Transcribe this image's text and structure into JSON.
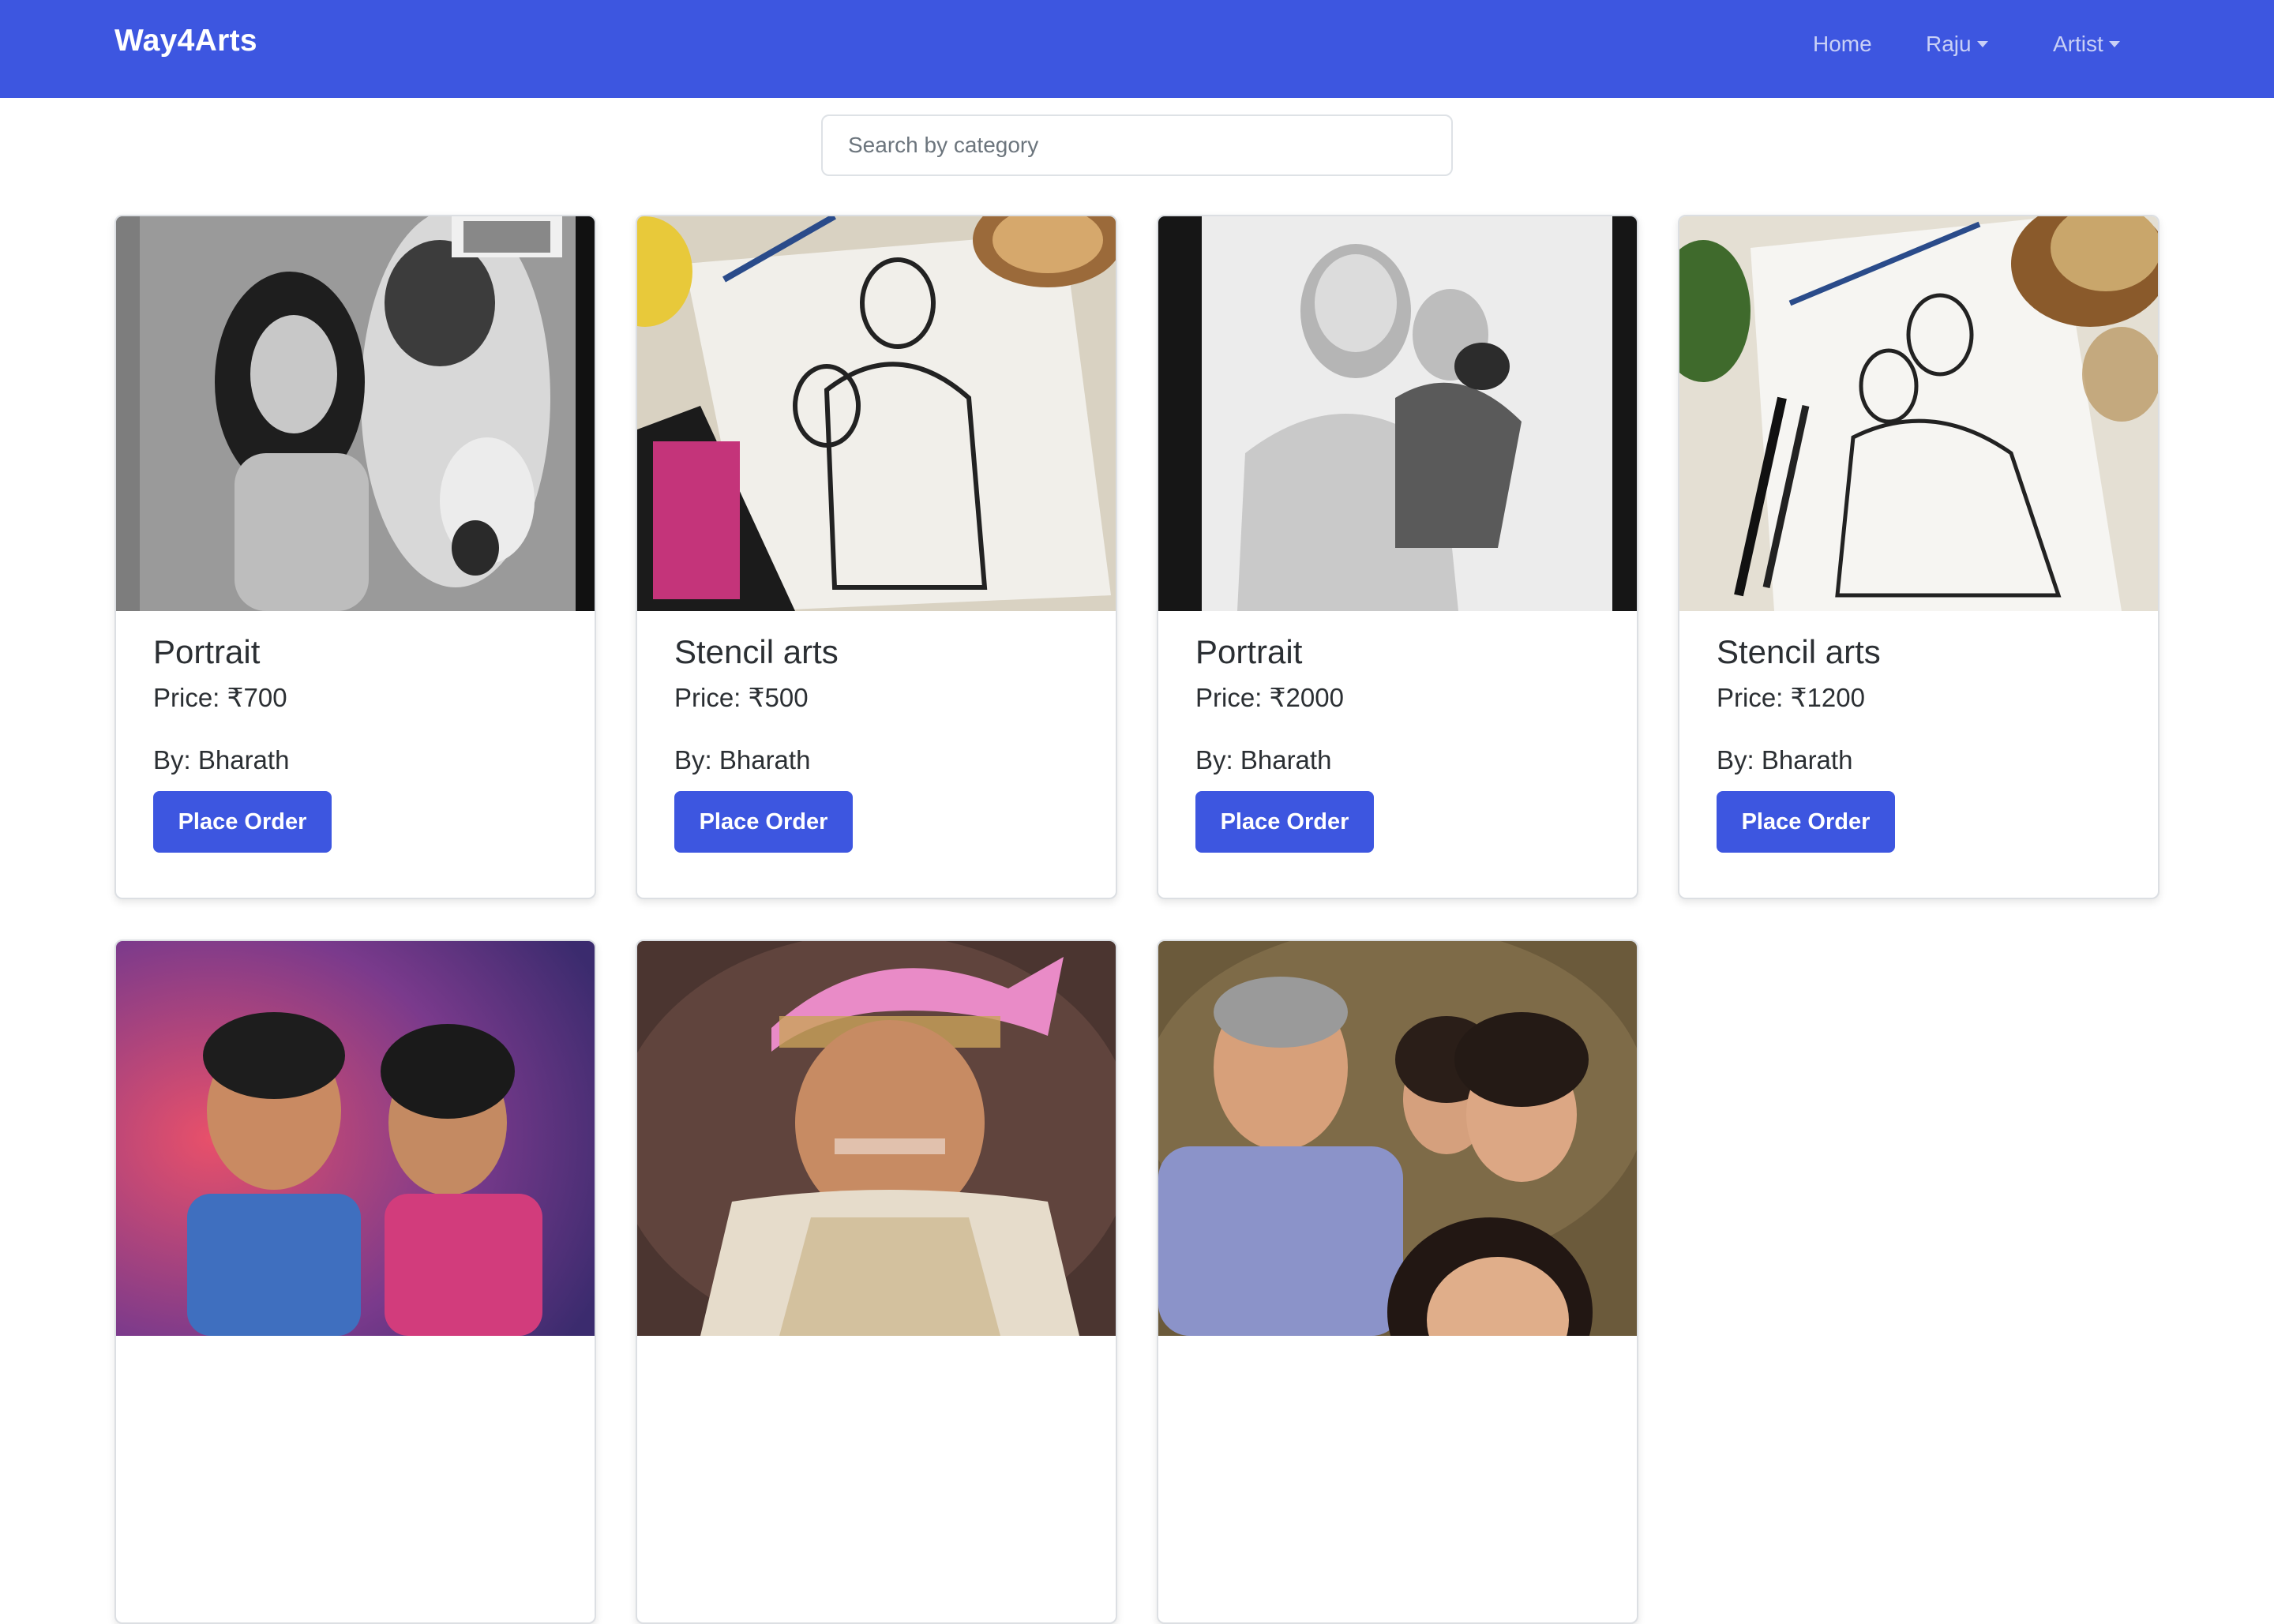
{
  "navbar": {
    "brand": "Way4Arts",
    "links": [
      {
        "label": "Home",
        "dropdown": false
      },
      {
        "label": "Raju",
        "dropdown": true
      },
      {
        "label": "Artist",
        "dropdown": true
      }
    ],
    "color": "#3d56e0"
  },
  "search": {
    "placeholder": "Search by category",
    "value": ""
  },
  "cards": [
    {
      "title": "Portrait",
      "price": "Price: ₹700",
      "by": "By: Bharath",
      "button": "Place Order"
    },
    {
      "title": "Stencil arts",
      "price": "Price: ₹500",
      "by": "By: Bharath",
      "button": "Place Order"
    },
    {
      "title": "Portrait",
      "price": "Price: ₹2000",
      "by": "By: Bharath",
      "button": "Place Order"
    },
    {
      "title": "Stencil arts",
      "price": "Price: ₹1200",
      "by": "By: Bharath",
      "button": "Place Order"
    },
    {
      "title": "",
      "price": "",
      "by": "",
      "button": ""
    },
    {
      "title": "",
      "price": "",
      "by": "",
      "button": ""
    },
    {
      "title": "",
      "price": "",
      "by": "",
      "button": ""
    }
  ]
}
